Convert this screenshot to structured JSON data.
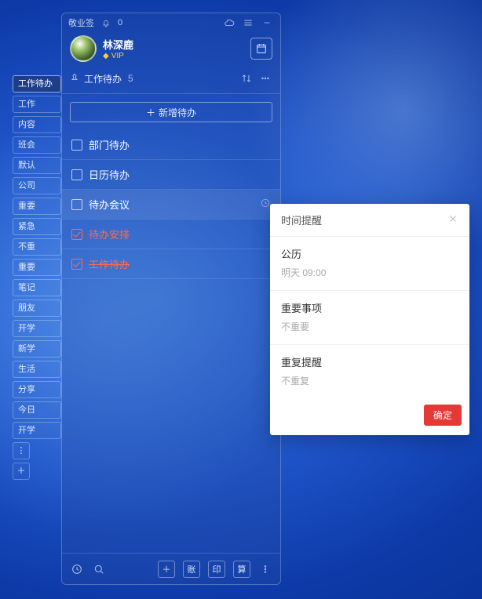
{
  "titlebar": {
    "app_name": "敬业签",
    "bell_count": "0"
  },
  "profile": {
    "username": "林深鹿",
    "vip": "VIP"
  },
  "section": {
    "title": "工作待办",
    "count": "5"
  },
  "add_button": "新增待办",
  "tags": [
    "工作待办",
    "工作",
    "内容",
    "班会",
    "默认",
    "公司",
    "重要",
    "紧急",
    "不重",
    "重要",
    "笔记",
    "朋友",
    "开学",
    "新学",
    "生活",
    "分享",
    "今日",
    "开学"
  ],
  "active_tag_index": 0,
  "items": [
    {
      "label": "部门待办",
      "checked": false,
      "done": false,
      "strike": false,
      "show_clock": false
    },
    {
      "label": "日历待办",
      "checked": false,
      "done": false,
      "strike": false,
      "show_clock": false
    },
    {
      "label": "待办会议",
      "checked": false,
      "done": false,
      "strike": false,
      "show_clock": true
    },
    {
      "label": "待办安排",
      "checked": true,
      "done": true,
      "strike": false,
      "show_clock": false
    },
    {
      "label": "工作待办",
      "checked": true,
      "done": true,
      "strike": true,
      "show_clock": false
    }
  ],
  "highlight_index": 2,
  "footer": {
    "btns": [
      "账",
      "印",
      "算"
    ]
  },
  "popup": {
    "title": "时间提醒",
    "sections": [
      {
        "k": "公历",
        "v": "明天 09:00"
      },
      {
        "k": "重要事项",
        "v": "不重要"
      },
      {
        "k": "重复提醒",
        "v": "不重复"
      }
    ],
    "ok": "确定"
  }
}
